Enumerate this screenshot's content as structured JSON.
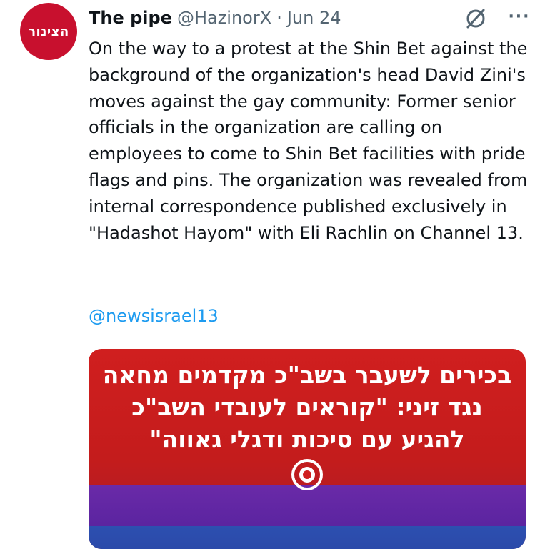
{
  "author": {
    "avatar_text": "הצינור",
    "display_name": "The pipe",
    "handle": "@HazinorX",
    "separator": "·",
    "date": "Jun 24"
  },
  "actions": {
    "grok_icon": "grok-icon",
    "more_label": "···"
  },
  "tweet": {
    "text": "On the way to a protest at the Shin Bet against the background of the organization's head David Zini's moves against the gay community: Former senior officials in the organization are calling on employees to come to Shin Bet facilities with pride flags and pins. The organization was revealed from internal correspondence published exclusively in \"Hadashot Hayom\" with Eli Rachlin on Channel 13.",
    "mention": "@newsisrael13"
  },
  "media": {
    "headline_lines": [
      "בכירים לשעבר בשב\"כ מקדמים מחאה",
      "נגד זיני: \"קוראים לעובדי השב\"כ",
      "להגיע עם סיכות ודגלי גאווה\""
    ],
    "colors": {
      "red": "#d01f1f",
      "purple": "#5b24a0",
      "blue": "#2a49a8"
    }
  },
  "colors": {
    "text": "#0f1419",
    "secondary": "#536471",
    "link": "#1d9bf0",
    "avatar_bg": "#c8102e"
  }
}
